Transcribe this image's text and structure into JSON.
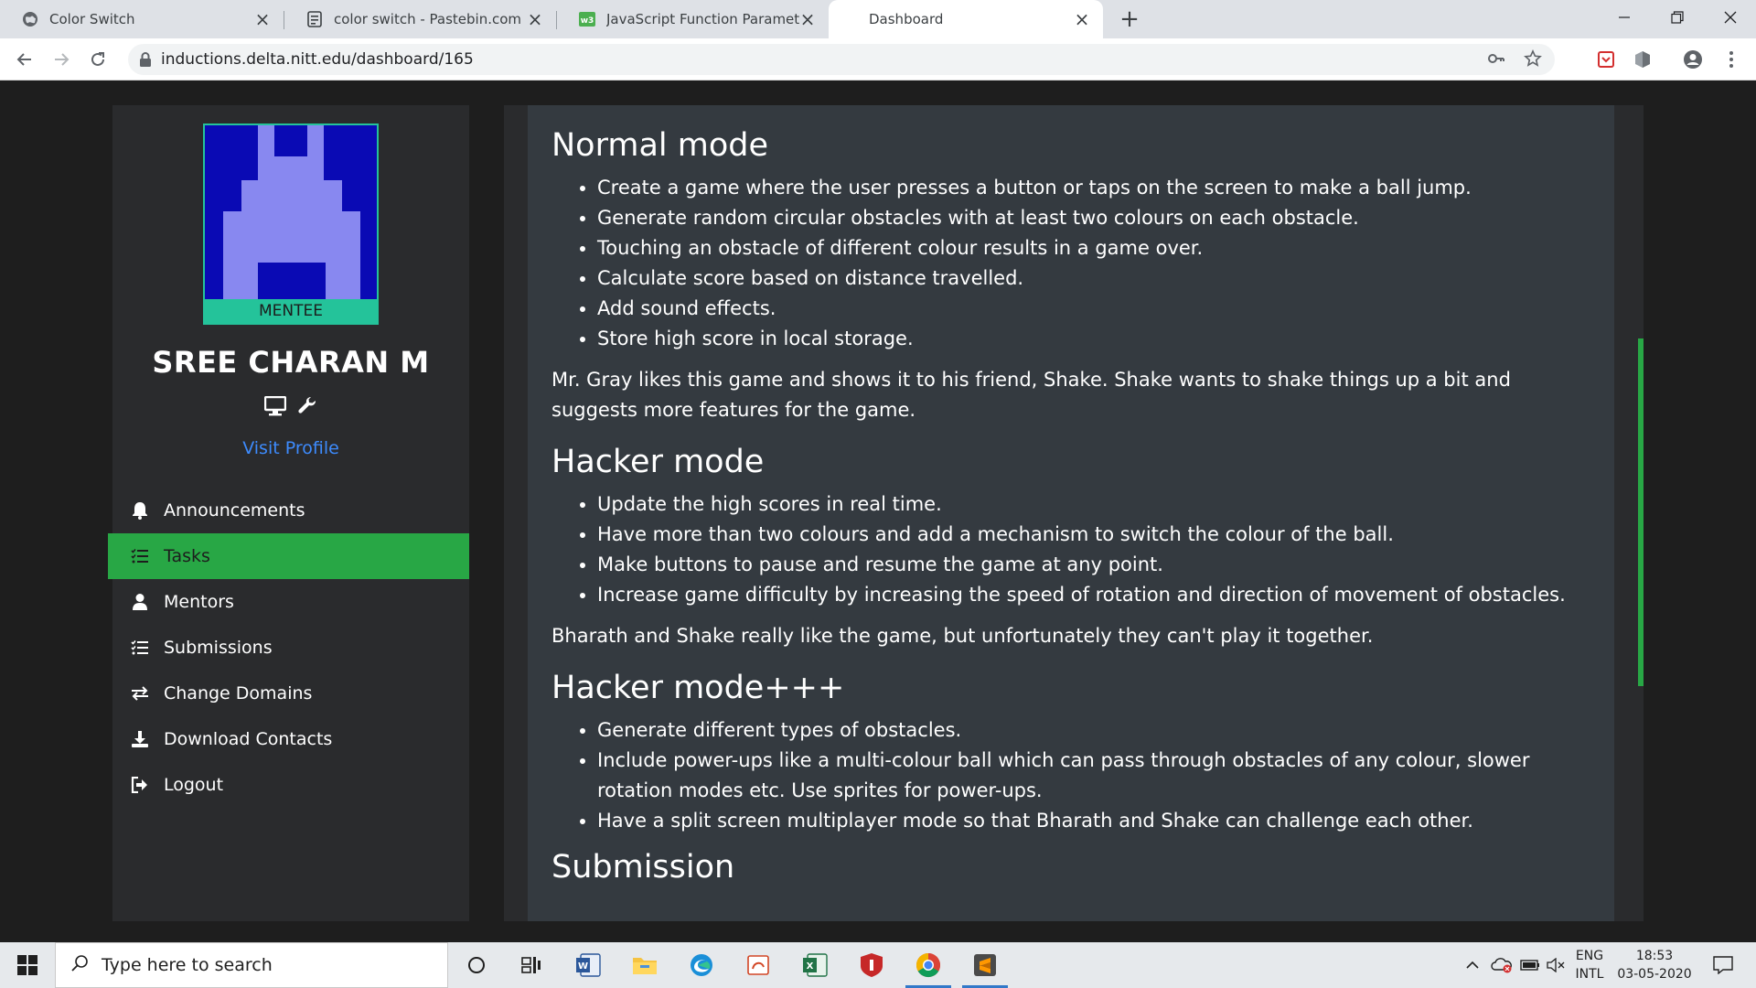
{
  "browser": {
    "tabs": [
      {
        "title": "Color Switch",
        "icon": "globe-icon",
        "active": false
      },
      {
        "title": "color switch - Pastebin.com",
        "icon": "pastebin-icon",
        "active": false
      },
      {
        "title": "JavaScript Function Parameters",
        "icon": "w3schools-icon",
        "active": false
      },
      {
        "title": "Dashboard",
        "icon": "none",
        "active": true
      }
    ],
    "new_tab_label": "+",
    "url": "inductions.delta.nitt.edu/dashboard/165"
  },
  "sidebar": {
    "badge": "MENTEE",
    "name": "SREE CHARAN M",
    "visit_profile": "Visit Profile",
    "menu": [
      {
        "label": "Announcements",
        "icon": "bell-icon"
      },
      {
        "label": "Tasks",
        "icon": "tasks-icon",
        "active": true
      },
      {
        "label": "Mentors",
        "icon": "user-icon"
      },
      {
        "label": "Submissions",
        "icon": "list-icon"
      },
      {
        "label": "Change Domains",
        "icon": "swap-icon"
      },
      {
        "label": "Download Contacts",
        "icon": "download-icon"
      },
      {
        "label": "Logout",
        "icon": "logout-icon"
      }
    ],
    "active_color": "#28a745"
  },
  "content": {
    "normal_title": "Normal mode",
    "normal_items": [
      "Create a game where the user presses a button or taps on the screen to make a ball jump.",
      "Generate random circular obstacles with at least two colours on each obstacle.",
      "Touching an obstacle of different colour results in a game over.",
      "Calculate score based on distance travelled.",
      "Add sound effects.",
      "Store high score in local storage."
    ],
    "para1": "Mr. Gray likes this game and shows it to his friend, Shake. Shake wants to shake things up a bit and suggests more features for the game.",
    "hacker_title": "Hacker mode",
    "hacker_items": [
      "Update the high scores in real time.",
      "Have more than two colours and add a mechanism to switch the colour of the ball.",
      "Make buttons to pause and resume the game at any point.",
      "Increase game difficulty by increasing the speed of rotation and direction of movement of obstacles."
    ],
    "para2": "Bharath and Shake really like the game, but unfortunately they can't play it together.",
    "hackerpp_title": "Hacker mode+++",
    "hackerpp_items": [
      "Generate different types of obstacles.",
      "Include power-ups like a multi-colour ball which can pass through obstacles of any colour, slower rotation modes etc. Use sprites for power-ups.",
      "Have a split screen multiplayer mode so that Bharath and Shake can challenge each other."
    ],
    "submission_title": "Submission"
  },
  "taskbar": {
    "search_placeholder": "Type here to search",
    "lang_top": "ENG",
    "lang_bottom": "INTL",
    "time": "18:53",
    "date": "03-05-2020"
  }
}
